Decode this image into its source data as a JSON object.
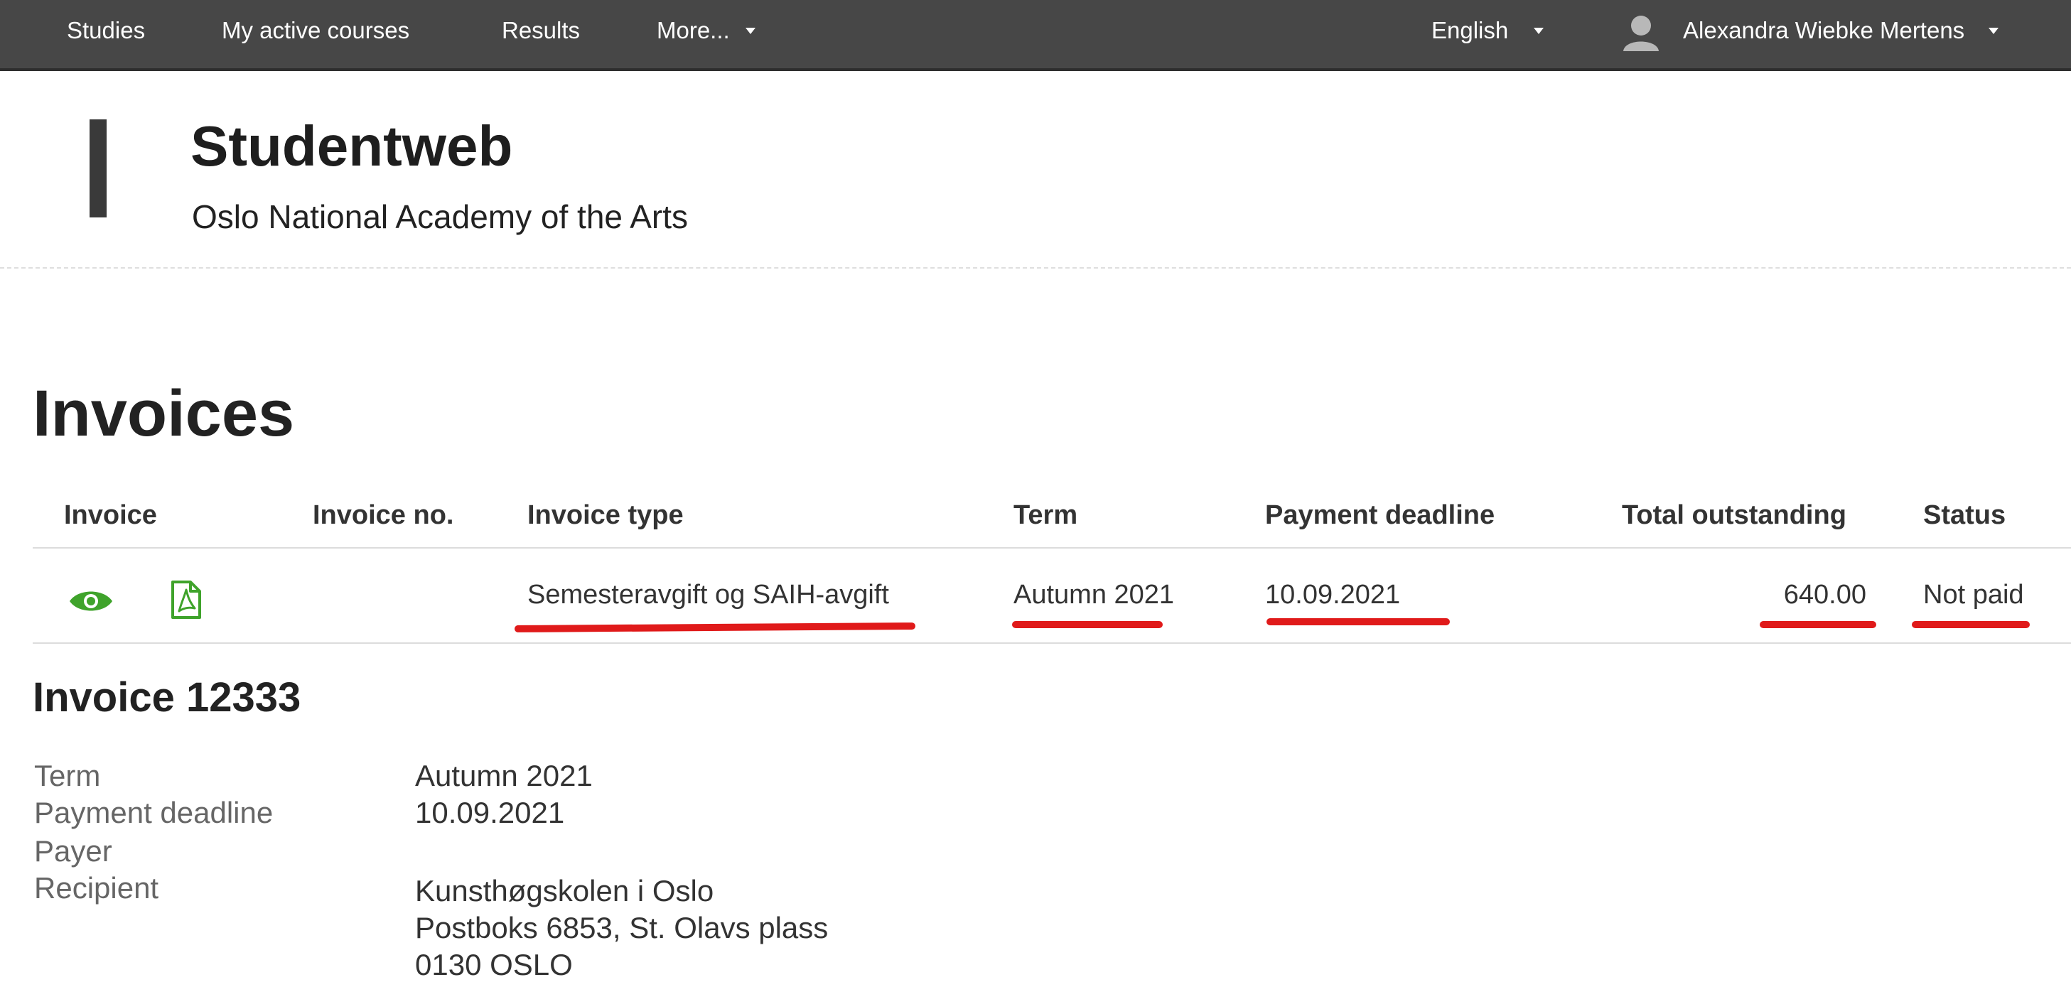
{
  "topbar": {
    "nav": [
      "Studies",
      "My active courses",
      "Results",
      "More..."
    ],
    "language": "English",
    "user_name": "Alexandra Wiebke Mertens"
  },
  "site": {
    "title": "Studentweb",
    "subtitle": "Oslo National Academy of the Arts"
  },
  "page": {
    "heading": "Invoices"
  },
  "table": {
    "columns": [
      "Invoice",
      "Invoice no.",
      "Invoice type",
      "Term",
      "Payment deadline",
      "Total outstanding",
      "Status"
    ],
    "rows": [
      {
        "invoice_no": "",
        "type": "Semesteravgift og SAIH-avgift",
        "term": "Autumn 2021",
        "deadline": "10.09.2021",
        "outstanding": "640.00",
        "status": "Not paid"
      }
    ]
  },
  "detail": {
    "heading": "Invoice 12333",
    "labels": {
      "term": "Term",
      "deadline": "Payment deadline",
      "payer": "Payer",
      "recipient": "Recipient"
    },
    "values": {
      "term": "Autumn 2021",
      "deadline": "10.09.2021",
      "payer": "",
      "recipient_lines": [
        "Kunsthøgskolen i Oslo",
        "Postboks 6853, St. Olavs plass",
        "0130 OSLO"
      ]
    }
  },
  "icons": {
    "view": "eye-icon",
    "pdf": "pdf-file-icon",
    "avatar": "user-avatar-icon"
  },
  "colors": {
    "topbar": "#474747",
    "icon_green": "#3fa32b",
    "annotation_red": "#e01a1a"
  }
}
